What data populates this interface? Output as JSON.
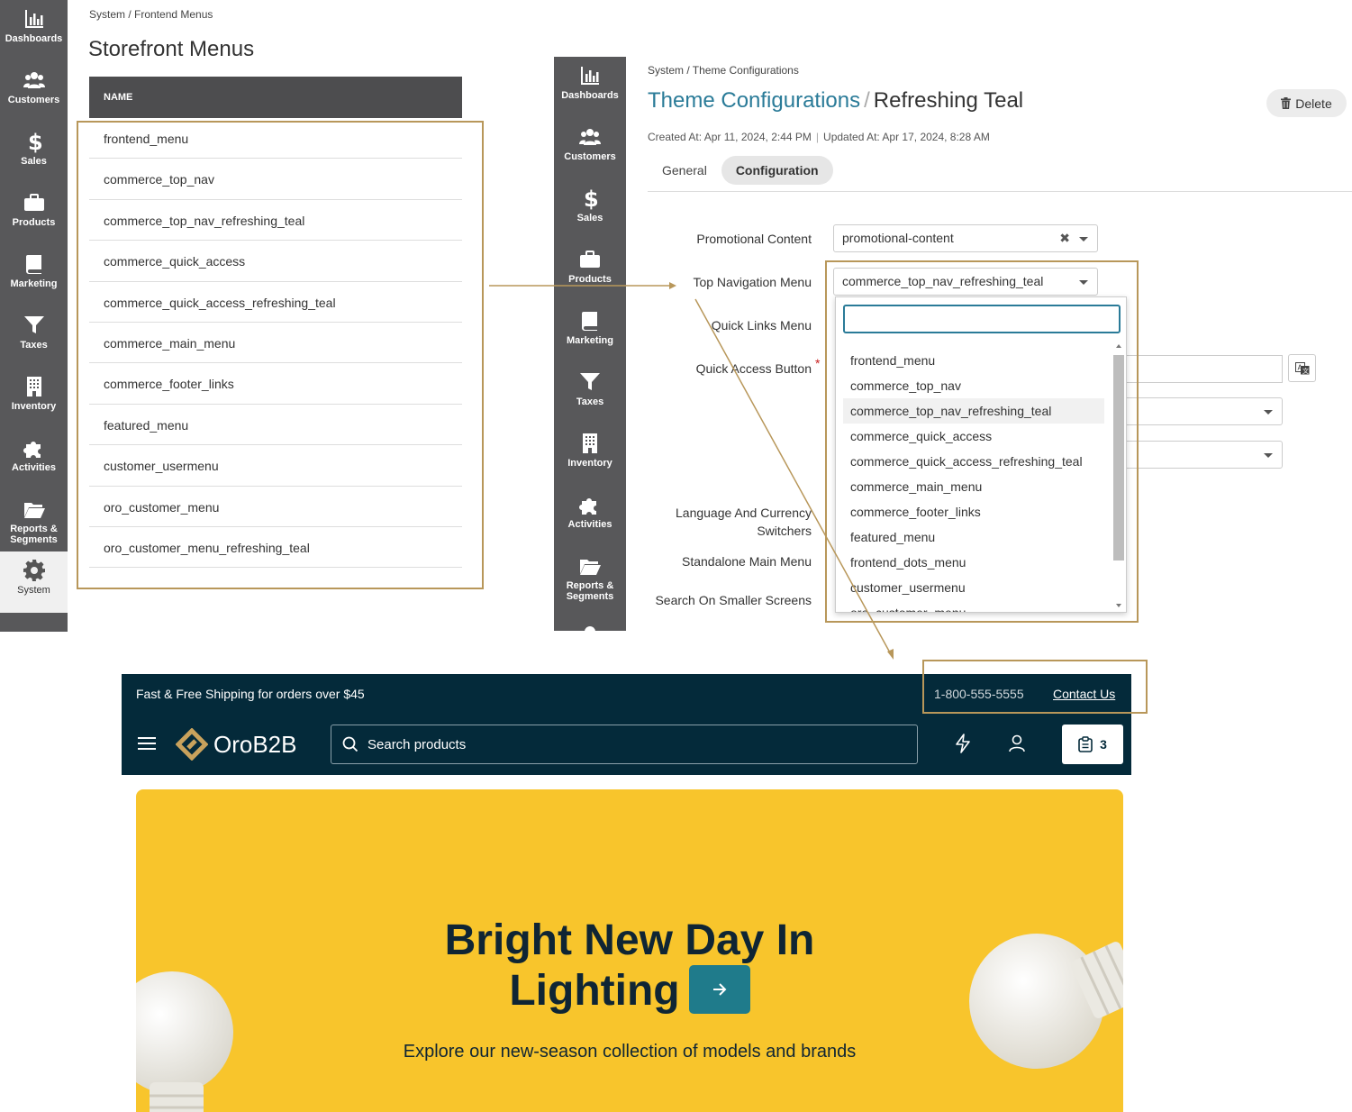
{
  "sidebar": {
    "items": [
      {
        "label": "Dashboards",
        "icon": "chart-bars-icon"
      },
      {
        "label": "Customers",
        "icon": "users-icon"
      },
      {
        "label": "Sales",
        "icon": "dollar-icon"
      },
      {
        "label": "Products",
        "icon": "briefcase-icon"
      },
      {
        "label": "Marketing",
        "icon": "book-icon"
      },
      {
        "label": "Taxes",
        "icon": "funnel-icon"
      },
      {
        "label": "Inventory",
        "icon": "building-icon"
      },
      {
        "label": "Activities",
        "icon": "puzzle-icon"
      },
      {
        "label": "Reports & Segments",
        "icon": "folder-open-icon"
      },
      {
        "label": "System",
        "icon": "gear-icon"
      }
    ]
  },
  "menus_panel": {
    "breadcrumb": "System / Frontend Menus",
    "title": "Storefront Menus",
    "column_header": "NAME",
    "rows": [
      "frontend_menu",
      "commerce_top_nav",
      "commerce_top_nav_refreshing_teal",
      "commerce_quick_access",
      "commerce_quick_access_refreshing_teal",
      "commerce_main_menu",
      "commerce_footer_links",
      "featured_menu",
      "customer_usermenu",
      "oro_customer_menu",
      "oro_customer_menu_refreshing_teal"
    ]
  },
  "theme_panel": {
    "breadcrumb": "System / Theme Configurations",
    "title_link": "Theme Configurations",
    "title_sep": "/",
    "title_name": "Refreshing Teal",
    "delete_label": "Delete",
    "created": "Created At: Apr 11, 2024, 2:44 PM",
    "updated": "Updated At: Apr 17, 2024, 8:28 AM",
    "tabs": [
      "General",
      "Configuration"
    ],
    "active_tab": "Configuration",
    "fields": {
      "promotional_label": "Promotional Content",
      "promotional_value": "promotional-content",
      "top_nav_label": "Top Navigation Menu",
      "top_nav_value": "commerce_top_nav_refreshing_teal",
      "quick_links_label": "Quick Links Menu",
      "quick_access_label": "Quick Access Button",
      "required_mark": "*",
      "language_label": "Language And Currency Switchers",
      "standalone_label": "Standalone Main Menu",
      "search_label": "Search On Smaller Screens"
    },
    "dropdown": {
      "search_value": "",
      "options": [
        "frontend_menu",
        "commerce_top_nav",
        "commerce_top_nav_refreshing_teal",
        "commerce_quick_access",
        "commerce_quick_access_refreshing_teal",
        "commerce_main_menu",
        "commerce_footer_links",
        "featured_menu",
        "frontend_dots_menu",
        "customer_usermenu",
        "oro_customer_menu"
      ],
      "hovered": "commerce_top_nav_refreshing_teal"
    }
  },
  "storefront": {
    "shipping": "Fast & Free Shipping for orders over $45",
    "phone": "1-800-555-5555",
    "contact": "Contact Us",
    "logo": "OroB2B",
    "search_placeholder": "Search products",
    "cart_count": "3",
    "hero_title_1": "Bright New Day In",
    "hero_title_2": "Lighting",
    "hero_subtitle": "Explore our new-season collection of models and brands"
  },
  "colors": {
    "sidebar": "#58585a",
    "highlight": "#b8975a",
    "link": "#2a7b98",
    "storefront_bar": "#042a3a",
    "hero": "#f8c52c",
    "hero_button": "#1f7b8b"
  }
}
